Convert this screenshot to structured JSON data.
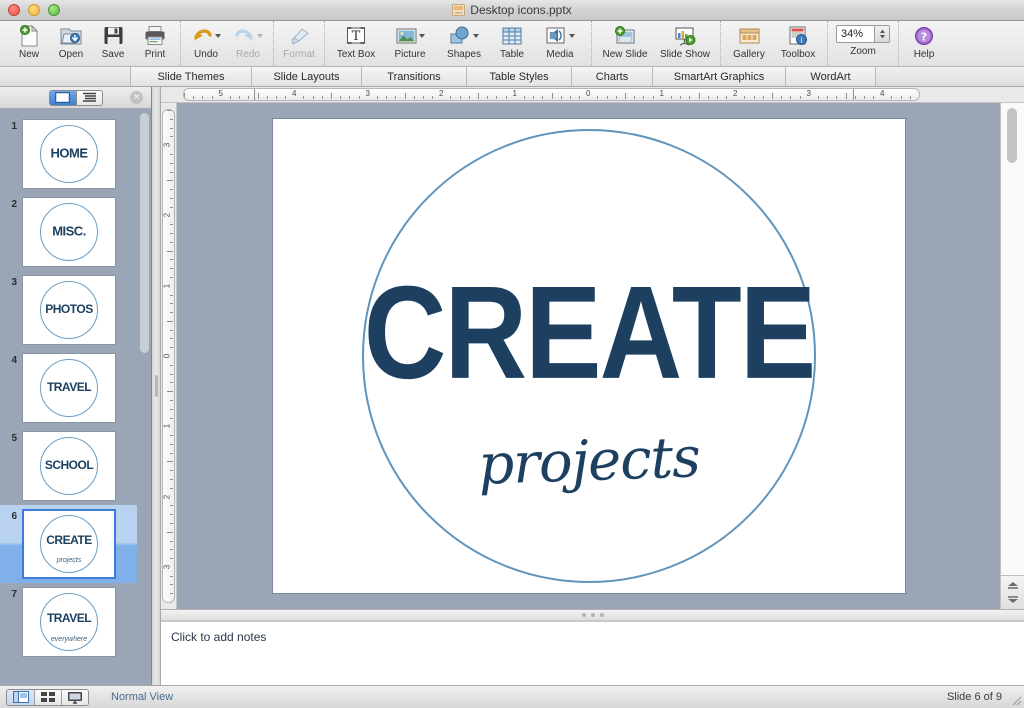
{
  "window": {
    "title": "Desktop icons.pptx",
    "doc_icon": "pptx-file-icon",
    "close": "close-button",
    "minimize": "minimize-button",
    "maximize": "maximize-button"
  },
  "toolbar": {
    "groups": [
      {
        "items": [
          {
            "label": "New",
            "icon": "new-document-icon",
            "disabled": false,
            "dropdown": false
          },
          {
            "label": "Open",
            "icon": "open-folder-icon",
            "disabled": false,
            "dropdown": false
          },
          {
            "label": "Save",
            "icon": "floppy-disk-icon",
            "disabled": false,
            "dropdown": false
          },
          {
            "label": "Print",
            "icon": "printer-icon",
            "disabled": false,
            "dropdown": false
          }
        ]
      },
      {
        "items": [
          {
            "label": "Undo",
            "icon": "undo-arrow-icon",
            "disabled": false,
            "dropdown": true
          },
          {
            "label": "Redo",
            "icon": "redo-arrow-icon",
            "disabled": true,
            "dropdown": true
          }
        ]
      },
      {
        "items": [
          {
            "label": "Format",
            "icon": "paintbrush-icon",
            "disabled": true,
            "dropdown": false
          }
        ]
      },
      {
        "items": [
          {
            "label": "Text Box",
            "icon": "text-box-icon",
            "disabled": false,
            "dropdown": false
          },
          {
            "label": "Picture",
            "icon": "picture-icon",
            "disabled": false,
            "dropdown": true
          },
          {
            "label": "Shapes",
            "icon": "shapes-icon",
            "disabled": false,
            "dropdown": true
          },
          {
            "label": "Table",
            "icon": "table-grid-icon",
            "disabled": false,
            "dropdown": false
          },
          {
            "label": "Media",
            "icon": "media-icon",
            "disabled": false,
            "dropdown": true
          }
        ]
      },
      {
        "items": [
          {
            "label": "New Slide",
            "icon": "new-slide-icon",
            "disabled": false,
            "dropdown": false
          },
          {
            "label": "Slide Show",
            "icon": "slide-show-icon",
            "disabled": false,
            "dropdown": false
          }
        ]
      },
      {
        "items": [
          {
            "label": "Gallery",
            "icon": "gallery-icon",
            "disabled": false,
            "dropdown": false
          },
          {
            "label": "Toolbox",
            "icon": "toolbox-icon",
            "disabled": false,
            "dropdown": false
          }
        ]
      },
      {
        "items": []
      },
      {
        "items": [
          {
            "label": "Help",
            "icon": "help-question-icon",
            "disabled": false,
            "dropdown": false
          }
        ]
      }
    ],
    "zoom": {
      "label": "Zoom",
      "value": "34%",
      "stepper_icon": "stepper-arrows-icon"
    }
  },
  "tabs": [
    {
      "label": "Slide Themes",
      "active": false
    },
    {
      "label": "Slide Layouts",
      "active": false
    },
    {
      "label": "Transitions",
      "active": false
    },
    {
      "label": "Table Styles",
      "active": false
    },
    {
      "label": "Charts",
      "active": false
    },
    {
      "label": "SmartArt Graphics",
      "active": false
    },
    {
      "label": "WordArt",
      "active": false
    }
  ],
  "sidebar": {
    "view_slides_icon": "slides-view-icon",
    "view_outline_icon": "outline-view-icon",
    "close_icon": "close-panel-icon",
    "slides": [
      {
        "number": "1",
        "title": "HOME",
        "subtitle": "",
        "selected": false
      },
      {
        "number": "2",
        "title": "MISC.",
        "subtitle": "",
        "selected": false
      },
      {
        "number": "3",
        "title": "PHOTOS",
        "subtitle": "",
        "selected": false
      },
      {
        "number": "4",
        "title": "TRAVEL",
        "subtitle": "",
        "selected": false
      },
      {
        "number": "5",
        "title": "SCHOOL",
        "subtitle": "",
        "selected": false
      },
      {
        "number": "6",
        "title": "CREATE",
        "subtitle": "projects",
        "selected": true
      },
      {
        "number": "7",
        "title": "TRAVEL",
        "subtitle": "everywhere",
        "selected": false
      }
    ]
  },
  "ruler": {
    "horizontal": [
      "5",
      "4",
      "3",
      "2",
      "1",
      "0",
      "1",
      "2",
      "3",
      "4"
    ],
    "vertical": [
      "3",
      "2",
      "1",
      "0",
      "1",
      "2",
      "3"
    ]
  },
  "slide": {
    "title": "CREATE",
    "subtitle": "projects",
    "circle_color": "#5f94bd",
    "text_color": "#1d4061",
    "background": "#ffffff"
  },
  "notes": {
    "placeholder": "Click to add notes"
  },
  "statusbar": {
    "view_normal_icon": "normal-view-icon",
    "view_sorter_icon": "slide-sorter-icon",
    "view_show_icon": "presenter-view-icon",
    "view_label": "Normal View",
    "slide_counter": "Slide 6 of 9"
  },
  "scrollbars": {
    "sidebar_scroll": "sidebar-scrollbar",
    "canvas_scroll": "canvas-scrollbar",
    "prev_slide_icon": "previous-slide-icon",
    "next_slide_icon": "next-slide-icon"
  }
}
